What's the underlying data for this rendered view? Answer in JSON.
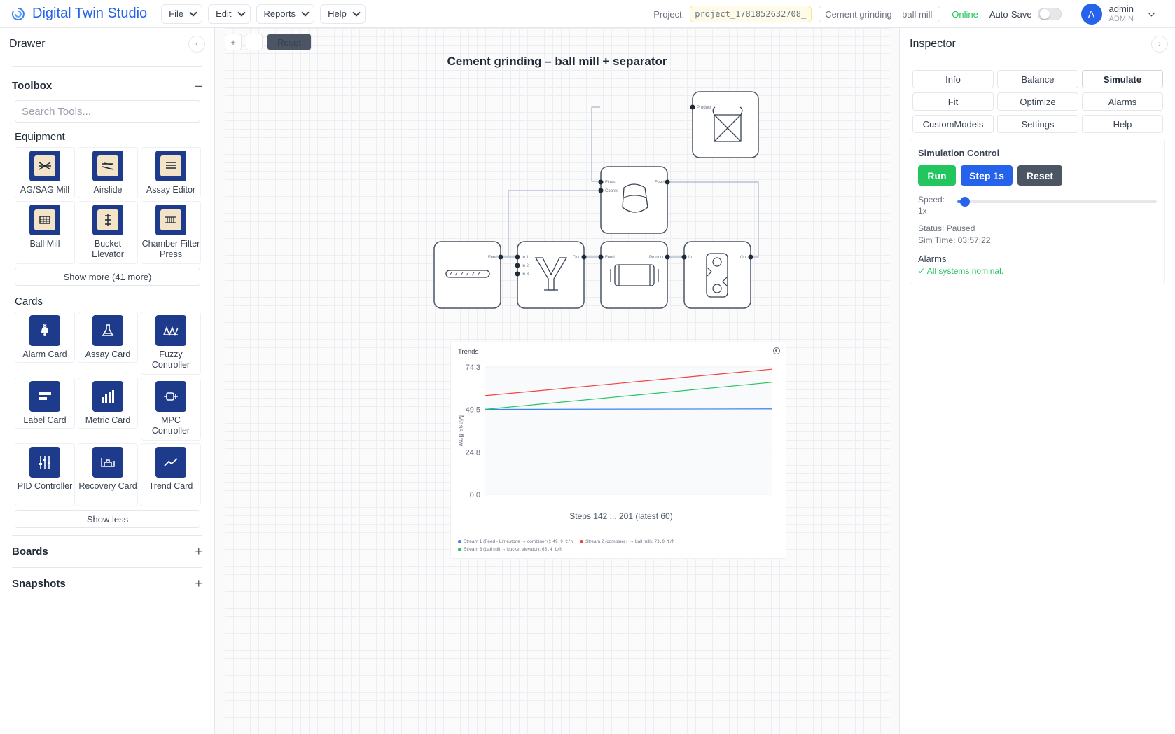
{
  "app": {
    "title": "Digital Twin Studio"
  },
  "menus": [
    "File",
    "Edit",
    "Reports",
    "Help"
  ],
  "project": {
    "label": "Project:",
    "id": "project_1781852632708_",
    "name": "Cement grinding – ball mill",
    "status": "Online",
    "autosave_label": "Auto-Save",
    "autosave_on": false
  },
  "user": {
    "initial": "A",
    "name": "admin",
    "role": "ADMIN"
  },
  "drawer": {
    "title": "Drawer",
    "toolbox": {
      "title": "Toolbox",
      "sign": "–",
      "search_placeholder": "Search Tools...",
      "equipment_title": "Equipment",
      "equipment": [
        "AG/SAG Mill",
        "Airslide",
        "Assay Editor",
        "Ball Mill",
        "Bucket Elevator",
        "Chamber Filter Press"
      ],
      "show_more": "Show more (41 more)",
      "cards_title": "Cards",
      "cards": [
        "Alarm Card",
        "Assay Card",
        "Fuzzy Controller",
        "Label Card",
        "Metric Card",
        "MPC Controller",
        "PID Controller",
        "Recovery Card",
        "Trend Card"
      ],
      "show_less": "Show less"
    },
    "boards": {
      "title": "Boards",
      "sign": "+"
    },
    "snapshots": {
      "title": "Snapshots",
      "sign": "+"
    }
  },
  "canvas": {
    "zoom_in": "+",
    "zoom_out": "-",
    "reset": "Reset",
    "title": "Cement grinding – ball mill + separator",
    "ports": {
      "product": "Product",
      "fines": "Fines",
      "coarse": "Coarse",
      "feed": "Feed",
      "in1": "In 1",
      "in2": "In 2",
      "in3": "In 3",
      "out": "Out",
      "in": "In"
    }
  },
  "trends": {
    "title": "Trends",
    "xlabel": "Steps 142 ... 201 (latest 60)",
    "legend": [
      {
        "label": "Stream 1 (Feed - Limestone → combiner+):",
        "value": "49.9 t/h",
        "color": "#3b82f6"
      },
      {
        "label": "Stream 2 (combiner+ → ball mill):",
        "value": "73.0 t/h",
        "color": "#ef4444"
      },
      {
        "label": "Stream 3 (ball mill → bucket elevator):",
        "value": "65.4 t/h",
        "color": "#22c55e"
      }
    ]
  },
  "chart_data": {
    "type": "line",
    "title": "Trends",
    "xlabel": "Steps 142 ... 201 (latest 60)",
    "ylabel": "Mass flow",
    "ylim": [
      0,
      74.3
    ],
    "yticks": [
      "74.3",
      "49.5",
      "24.8",
      "0.0"
    ],
    "x": [
      142,
      201
    ],
    "series": [
      {
        "name": "Stream 1 (Feed - Limestone → combiner+)",
        "values": [
          49.6,
          49.9
        ],
        "color": "#3b82f6"
      },
      {
        "name": "Stream 2 (combiner+ → ball mill)",
        "values": [
          57.6,
          73.0
        ],
        "color": "#ef4444"
      },
      {
        "name": "Stream 3 (ball mill → bucket elevator)",
        "values": [
          49.6,
          65.4
        ],
        "color": "#22c55e"
      }
    ]
  },
  "inspector": {
    "title": "Inspector",
    "tabs": [
      "Info",
      "Balance",
      "Simulate",
      "Fit",
      "Optimize",
      "Alarms",
      "CustomModels",
      "Settings",
      "Help"
    ],
    "active_tab": "Simulate",
    "sim": {
      "title": "Simulation Control",
      "run": "Run",
      "step": "Step 1s",
      "reset": "Reset",
      "speed_label": "Speed:",
      "speed_value": "1x",
      "speed_fraction": 0.04,
      "status": "Status: Paused",
      "sim_time": "Sim Time: 03:57:22",
      "alarms_title": "Alarms",
      "alarms_ok": "✓ All systems nominal."
    }
  }
}
